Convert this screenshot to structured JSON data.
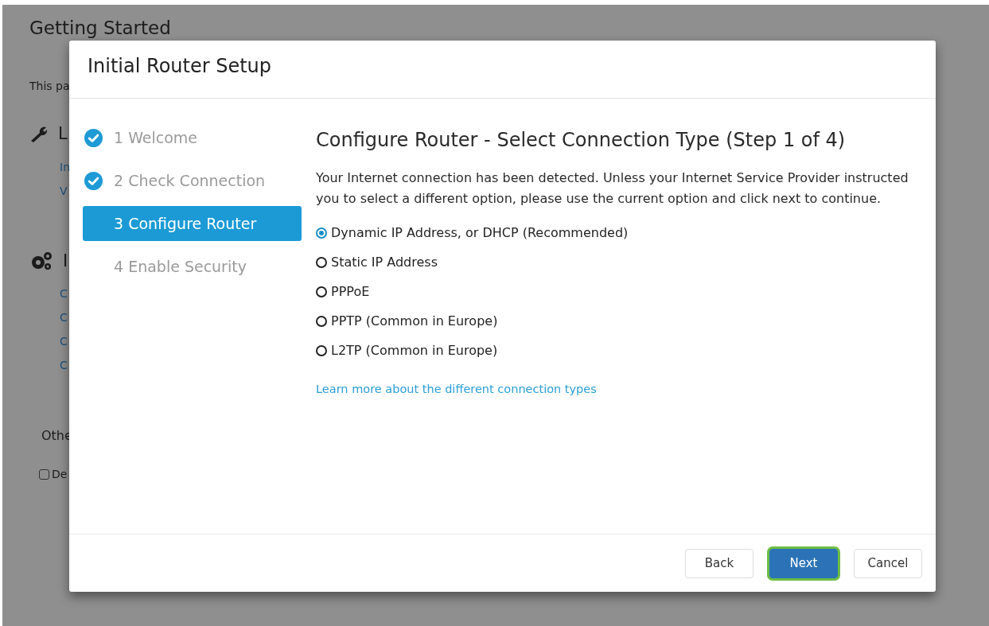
{
  "background_page": {
    "title": "Getting Started",
    "intro": "This pa",
    "sections": [
      {
        "kind": "wrench",
        "heading": "L",
        "links": [
          "In",
          "V"
        ]
      },
      {
        "kind": "gears",
        "heading": "I",
        "links": [
          "C",
          "C",
          "C",
          "C"
        ]
      }
    ],
    "other": {
      "heading": "Othe",
      "checkbox": {
        "label": "De",
        "checked": false
      }
    }
  },
  "dialog": {
    "title": "Initial Router Setup",
    "steps": [
      {
        "label": "1 Welcome",
        "completed": true,
        "selected": false
      },
      {
        "label": "2 Check Connection",
        "completed": true,
        "selected": false
      },
      {
        "label": "3 Configure Router",
        "completed": false,
        "selected": true
      },
      {
        "label": "4 Enable Security",
        "completed": false,
        "selected": false
      }
    ],
    "heading": "Configure Router - Select Connection Type (Step 1 of 4)",
    "description": "Your Internet connection has been detected. Unless your Internet Service Provider instructed you to select a different option, please use the current option and click next to continue.",
    "options": [
      {
        "label": "Dynamic IP Address, or DHCP (Recommended)",
        "selected": true
      },
      {
        "label": "Static IP Address",
        "selected": false
      },
      {
        "label": "PPPoE",
        "selected": false
      },
      {
        "label": "PPTP (Common in Europe)",
        "selected": false
      },
      {
        "label": "L2TP (Common in Europe)",
        "selected": false
      }
    ],
    "learn_more_link": "Learn more about the different connection types",
    "buttons": [
      {
        "label": "Back",
        "kind": "default",
        "focused": false
      },
      {
        "label": "Next",
        "kind": "primary",
        "focused": true
      },
      {
        "label": "Cancel",
        "kind": "default",
        "focused": false
      }
    ]
  }
}
